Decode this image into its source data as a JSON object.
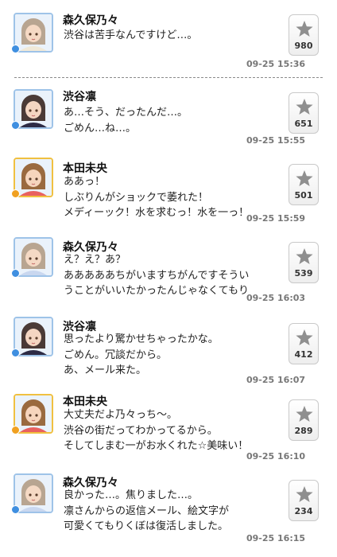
{
  "posts": [
    {
      "author": "森久保乃々",
      "lines": [
        "渋谷は苦手なんですけど…。"
      ],
      "likes": "980",
      "timestamp": "09-25 15:36",
      "avatar": {
        "skin": "#f5d9c4",
        "hair": "#b8a591",
        "outfit": "#f0e9d8",
        "frame": "#9ec3e8",
        "dot": "#3f8fe0"
      }
    },
    {
      "author": "渋谷凛",
      "lines": [
        "あ…そう、だったんだ…。",
        "ごめん…ね…。"
      ],
      "likes": "651",
      "timestamp": "09-25 15:55",
      "avatar": {
        "skin": "#f4d6c2",
        "hair": "#4a3a36",
        "outfit": "#2d2b45",
        "frame": "#9ec3e8",
        "dot": "#3f8fe0"
      }
    },
    {
      "author": "本田未央",
      "lines": [
        "ああっ！",
        "しぶりんがショックで萎れた！",
        "メディーック！水を求むっ！水を一っ！"
      ],
      "likes": "501",
      "timestamp": "09-25 15:59",
      "avatar": {
        "skin": "#f6d5bd",
        "hair": "#9a6a3f",
        "outfit": "#e86060",
        "frame": "#f0c040",
        "dot": "#f0a020"
      }
    },
    {
      "author": "森久保乃々",
      "lines": [
        "え？え？あ？",
        "あああああちがいますちがんですそうい",
        "うことがいいたかったんじゃなくてもり"
      ],
      "likes": "539",
      "timestamp": "09-25 16:03",
      "avatar": {
        "skin": "#f5d9c4",
        "hair": "#b8a591",
        "outfit": "#c9d7ef",
        "frame": "#9ec3e8",
        "dot": "#3f8fe0"
      }
    },
    {
      "author": "渋谷凛",
      "lines": [
        "思ったより驚かせちゃったかな。",
        "ごめん。冗談だから。",
        "あ、メール来た。"
      ],
      "likes": "412",
      "timestamp": "09-25 16:07",
      "avatar": {
        "skin": "#f4d6c2",
        "hair": "#4a3a36",
        "outfit": "#2d2b45",
        "frame": "#9ec3e8",
        "dot": "#3f8fe0"
      }
    },
    {
      "author": "本田未央",
      "lines": [
        "大丈夫だよ乃々っち～。",
        "渋谷の街だってわかってるから。",
        "そしてしまむ一がお水くれた☆美味い！"
      ],
      "likes": "289",
      "timestamp": "09-25 16:10",
      "avatar": {
        "skin": "#f6d5bd",
        "hair": "#9a6a3f",
        "outfit": "#e86060",
        "frame": "#f0c040",
        "dot": "#f0a020"
      }
    },
    {
      "author": "森久保乃々",
      "lines": [
        "良かった…。焦りました…。",
        "凛さんからの返信メール、絵文字が",
        "可愛くてもりくぼは復活しました。"
      ],
      "likes": "234",
      "timestamp": "09-25 16:15",
      "avatar": {
        "skin": "#f5d9c4",
        "hair": "#b8a591",
        "outfit": "#c9d7ef",
        "frame": "#9ec3e8",
        "dot": "#3f8fe0"
      }
    }
  ],
  "icons": {
    "like": "star-icon"
  },
  "colors": {
    "star": "#8f8f8f",
    "timestamp": "#777777",
    "divider": "#8a8a8a"
  }
}
